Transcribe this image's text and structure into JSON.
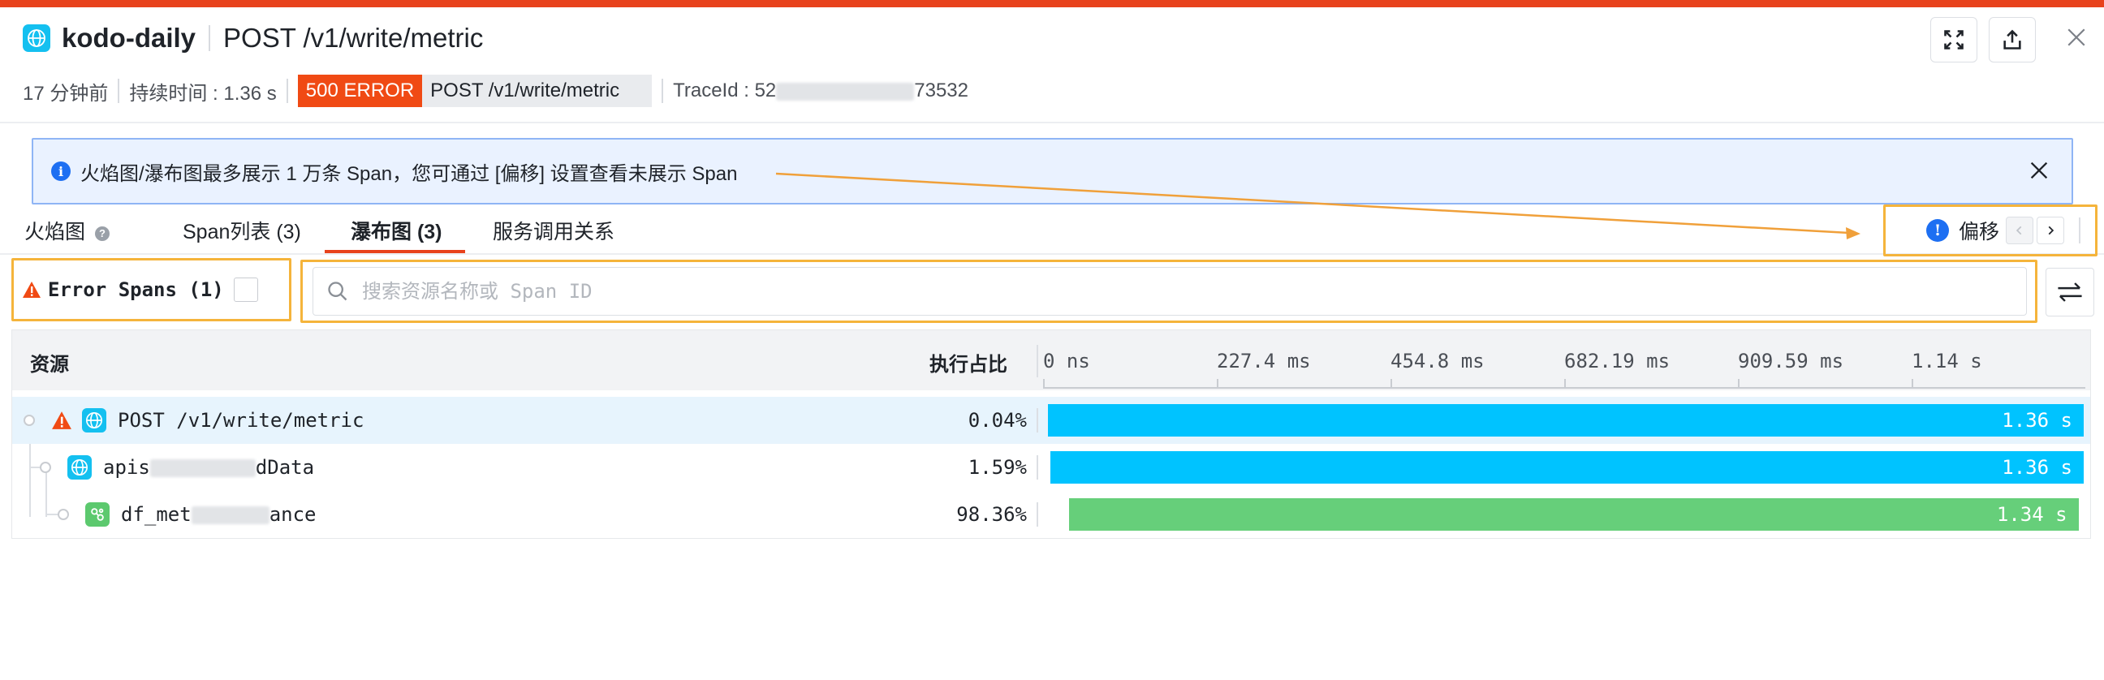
{
  "header": {
    "app_name": "kodo-daily",
    "path": "POST /v1/write/metric"
  },
  "meta": {
    "time_ago": "17 分钟前",
    "duration": "持续时间 : 1.36 s",
    "status": "500 ERROR",
    "method_path": "POST  /v1/write/metric",
    "trace_prefix": "TraceId : 52",
    "trace_suffix": "73532"
  },
  "notice": {
    "text": "火焰图/瀑布图最多展示 1 万条 Span，您可通过 [偏移] 设置查看未展示 Span"
  },
  "tabs": [
    {
      "label": "火焰图"
    },
    {
      "label": "Span列表 (3)"
    },
    {
      "label": "瀑布图 (3)"
    },
    {
      "label": "服务调用关系"
    }
  ],
  "offset": {
    "label": "偏移"
  },
  "filters": {
    "error_spans_label": "Error Spans (1)",
    "search_placeholder": "搜索资源名称或 Span ID"
  },
  "table": {
    "col_resource": "资源",
    "col_ratio": "执行占比",
    "ticks": [
      "0 ns",
      "227.4 ms",
      "454.8 ms",
      "682.19 ms",
      "909.59 ms",
      "1.14 s"
    ],
    "rows": [
      {
        "name": "POST /v1/write/metric",
        "pct": "0.04%",
        "duration": "1.36 s",
        "start_frac": 0.0,
        "width_frac": 1.0
      },
      {
        "name_prefix": "apis",
        "name_suffix": "dData",
        "pct": "1.59%",
        "duration": "1.36 s",
        "start_frac": 0.002,
        "width_frac": 0.998
      },
      {
        "name_prefix": "df_met",
        "name_suffix": "ance",
        "pct": "98.36%",
        "duration": "1.34 s",
        "start_frac": 0.02,
        "width_frac": 0.975
      }
    ]
  },
  "colors": {
    "accent": "#e8421c",
    "http_bar": "#00c3ff",
    "service_bar": "#66cf7a",
    "error": "#f04a14",
    "highlight_border": "#f5b43b"
  }
}
